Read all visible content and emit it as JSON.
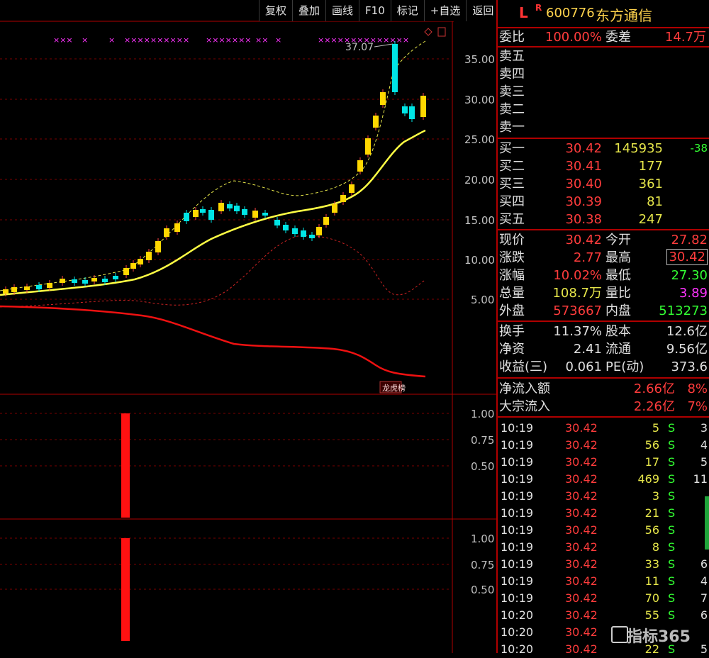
{
  "toolbar": {
    "buttons": [
      "复权",
      "叠加",
      "画线",
      "F10",
      "标记",
      "+自选",
      "返回"
    ]
  },
  "chart": {
    "price_axis": [
      "35.00",
      "30.00",
      "25.00",
      "20.00",
      "15.00",
      "10.00",
      "5.00"
    ],
    "max_label": "37.07",
    "ind_axis_1": [
      "1.00",
      "0.75",
      "0.50"
    ],
    "ind_axis_2": [
      "1.00",
      "0.75",
      "0.50"
    ],
    "tag": "龙虎榜"
  },
  "stock": {
    "flag": "L",
    "r": "R",
    "code": "600776",
    "name": "东方通信"
  },
  "order": {
    "ratio_label": "委比",
    "ratio_value": "100.00%",
    "diff_label": "委差",
    "diff_value": "14.7万",
    "asks": [
      "卖五",
      "卖四",
      "卖三",
      "卖二",
      "卖一"
    ],
    "bids": [
      {
        "label": "买一",
        "price": "30.42",
        "vol": "145935",
        "chg": "-38"
      },
      {
        "label": "买二",
        "price": "30.41",
        "vol": "177",
        "chg": ""
      },
      {
        "label": "买三",
        "price": "30.40",
        "vol": "361",
        "chg": ""
      },
      {
        "label": "买四",
        "price": "30.39",
        "vol": "81",
        "chg": ""
      },
      {
        "label": "买五",
        "price": "30.38",
        "vol": "247",
        "chg": ""
      }
    ]
  },
  "quote": [
    {
      "l1": "现价",
      "v1": "30.42",
      "l2": "今开",
      "v2": "27.82"
    },
    {
      "l1": "涨跌",
      "v1": "2.77",
      "l2": "最高",
      "v2": "30.42"
    },
    {
      "l1": "涨幅",
      "v1": "10.02%",
      "l2": "最低",
      "v2": "27.30"
    },
    {
      "l1": "总量",
      "v1": "108.7万",
      "l2": "量比",
      "v2": "3.89"
    },
    {
      "l1": "外盘",
      "v1": "573667",
      "l2": "内盘",
      "v2": "513273"
    }
  ],
  "fund": [
    {
      "l1": "换手",
      "v1": "11.37%",
      "l2": "股本",
      "v2": "12.6亿"
    },
    {
      "l1": "净资",
      "v1": "2.41",
      "l2": "流通",
      "v2": "9.56亿"
    },
    {
      "l1": "收益(三)",
      "v1": "0.061",
      "l2": "PE(动)",
      "v2": "373.6"
    }
  ],
  "flow": [
    {
      "label": "净流入额",
      "value": "2.66亿",
      "pct": "8%"
    },
    {
      "label": "大宗流入",
      "value": "2.26亿",
      "pct": "7%"
    }
  ],
  "ticks": [
    {
      "t": "10:19",
      "p": "30.42",
      "v": "5",
      "s": "S",
      "n": "3"
    },
    {
      "t": "10:19",
      "p": "30.42",
      "v": "56",
      "s": "S",
      "n": "4"
    },
    {
      "t": "10:19",
      "p": "30.42",
      "v": "17",
      "s": "S",
      "n": "5"
    },
    {
      "t": "10:19",
      "p": "30.42",
      "v": "469",
      "s": "S",
      "n": "11"
    },
    {
      "t": "10:19",
      "p": "30.42",
      "v": "3",
      "s": "S",
      "n": ""
    },
    {
      "t": "10:19",
      "p": "30.42",
      "v": "21",
      "s": "S",
      "n": ""
    },
    {
      "t": "10:19",
      "p": "30.42",
      "v": "56",
      "s": "S",
      "n": ""
    },
    {
      "t": "10:19",
      "p": "30.42",
      "v": "8",
      "s": "S",
      "n": ""
    },
    {
      "t": "10:19",
      "p": "30.42",
      "v": "33",
      "s": "S",
      "n": "6"
    },
    {
      "t": "10:19",
      "p": "30.42",
      "v": "11",
      "s": "S",
      "n": "4"
    },
    {
      "t": "10:19",
      "p": "30.42",
      "v": "70",
      "s": "S",
      "n": "7"
    },
    {
      "t": "10:20",
      "p": "30.42",
      "v": "55",
      "s": "S",
      "n": "6"
    },
    {
      "t": "10:20",
      "p": "30.42",
      "v": "",
      "s": "",
      "n": ""
    },
    {
      "t": "10:20",
      "p": "30.42",
      "v": "22",
      "s": "S",
      "n": "5"
    }
  ],
  "watermark": "指标365",
  "colors": {
    "up": "#ffd700",
    "down": "#00e5e5",
    "ma_main": "#ffff44",
    "bound": "#ff2020",
    "grid": "#7a0000"
  }
}
